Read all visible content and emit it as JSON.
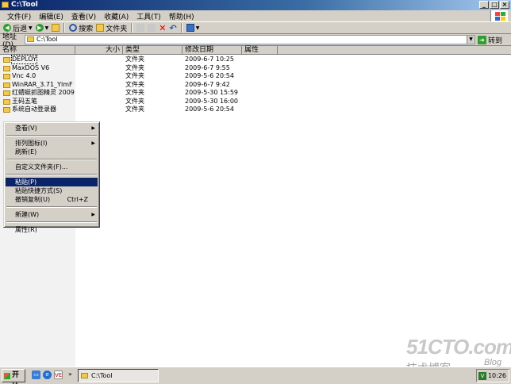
{
  "window": {
    "title": "C:\\Tool"
  },
  "menubar": [
    "文件(F)",
    "编辑(E)",
    "查看(V)",
    "收藏(A)",
    "工具(T)",
    "帮助(H)"
  ],
  "toolbar": {
    "back": "后退",
    "search": "搜索",
    "folders": "文件夹"
  },
  "address": {
    "label": "地址(D)",
    "value": "C:\\Tool",
    "go": "转到"
  },
  "columns": [
    "名称",
    "大小",
    "类型",
    "修改日期",
    "属性"
  ],
  "files": [
    {
      "name": "DEPLOY",
      "type": "文件夹",
      "date": "2009-6-7 10:25"
    },
    {
      "name": "MaxDOS V6",
      "type": "文件夹",
      "date": "2009-6-7 9:55"
    },
    {
      "name": "Vnc 4.0",
      "type": "文件夹",
      "date": "2009-5-6 20:54"
    },
    {
      "name": "WinRAR_3.71_YlmF",
      "type": "文件夹",
      "date": "2009-6-7 9:42"
    },
    {
      "name": "红蜻蜓抓图精灵 2009",
      "type": "文件夹",
      "date": "2009-5-30 15:59"
    },
    {
      "name": "王码五笔",
      "type": "文件夹",
      "date": "2009-5-30 16:00"
    },
    {
      "name": "系统自动登录器",
      "type": "文件夹",
      "date": "2009-5-6 20:54"
    }
  ],
  "context_menu": {
    "view": "查看(V)",
    "arrange": "排列图标(I)",
    "refresh": "刷新(E)",
    "customize": "自定义文件夹(F)...",
    "paste": "粘贴(P)",
    "paste_shortcut": "粘贴快捷方式(S)",
    "undo": "撤销复制(U)",
    "undo_shortcut": "Ctrl+Z",
    "new": "新建(W)",
    "properties": "属性(R)"
  },
  "taskbar": {
    "start": "开始",
    "task": "C:\\Tool",
    "clock": "10:26",
    "quick_text": "VE"
  },
  "watermark": {
    "site": "51CTO.com",
    "cn": "技术博客",
    "blog": "Blog"
  }
}
